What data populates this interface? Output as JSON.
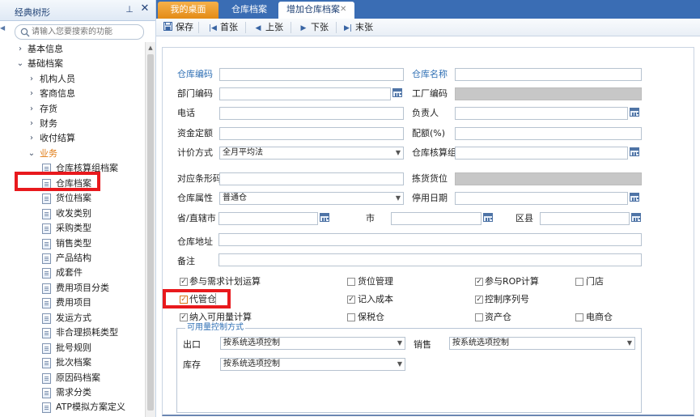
{
  "tree": {
    "title": "经典树形",
    "pin_glyph": "⊥",
    "close_glyph": "✕",
    "collapse_glyph": "◀",
    "search_placeholder": "请输入您要搜索的功能",
    "items": [
      {
        "label": "基本信息",
        "arrow": "›"
      },
      {
        "label": "基础档案",
        "arrow": "⌄"
      },
      {
        "label": "机构人员",
        "arrow": "›"
      },
      {
        "label": "客商信息",
        "arrow": "›"
      },
      {
        "label": "存货",
        "arrow": "›"
      },
      {
        "label": "财务",
        "arrow": "›"
      },
      {
        "label": "收付结算",
        "arrow": "›"
      },
      {
        "label": "业务",
        "arrow": "⌄"
      },
      {
        "label": "仓库核算组档案"
      },
      {
        "label": "仓库档案"
      },
      {
        "label": "货位档案"
      },
      {
        "label": "收发类别"
      },
      {
        "label": "采购类型"
      },
      {
        "label": "销售类型"
      },
      {
        "label": "产品结构"
      },
      {
        "label": "成套件"
      },
      {
        "label": "费用项目分类"
      },
      {
        "label": "费用项目"
      },
      {
        "label": "发运方式"
      },
      {
        "label": "非合理损耗类型"
      },
      {
        "label": "批号规则"
      },
      {
        "label": "批次档案"
      },
      {
        "label": "原因码档案"
      },
      {
        "label": "需求分类"
      },
      {
        "label": "ATP模拟方案定义"
      }
    ],
    "scroll_up_glyph": "▲"
  },
  "tabs": {
    "desktop": "我的桌面",
    "warehouse": "仓库档案",
    "add": "增加仓库档案",
    "close_glyph": "✕"
  },
  "toolbar": {
    "save": "保存",
    "first": "首张",
    "prev": "上张",
    "next": "下张",
    "last": "末张"
  },
  "form": {
    "labels": {
      "code": "仓库编码",
      "name": "仓库名称",
      "dept": "部门编码",
      "factory": "工厂编码",
      "phone": "电话",
      "manager": "负责人",
      "quota": "资金定额",
      "ratio": "配额(%)",
      "pricing": "计价方式",
      "acct_group": "仓库核算组",
      "barcode": "对应条形码",
      "picking": "拣货货位",
      "attr": "仓库属性",
      "stop_date": "停用日期",
      "province": "省/直辖市",
      "city": "市",
      "district": "区县",
      "address": "仓库地址",
      "remark": "备注"
    },
    "values": {
      "pricing": "全月平均法",
      "attr": "普通仓"
    },
    "checkboxes": {
      "mrp": "参与需求计划运算",
      "location_mgmt": "货位管理",
      "rop": "参与ROP计算",
      "store": "门店",
      "consign": "代管仓",
      "cost": "记入成本",
      "serial": "控制序列号",
      "available": "纳入可用量计算",
      "bonded": "保税仓",
      "asset": "资产仓",
      "ecom": "电商仓"
    },
    "check_mark": "✓",
    "group": {
      "title": "可用量控制方式",
      "outbound_label": "出口",
      "outbound_value": "按系统选项控制",
      "sales_label": "销售",
      "sales_value": "按系统选项控制",
      "stock_label": "库存",
      "stock_value": "按系统选项控制"
    },
    "dropdown_glyph": "▼"
  },
  "colors": {
    "accent_blue": "#3a6db4",
    "tab_orange": "#e38b16",
    "highlight_red": "#e8191d",
    "label_blue": "#2f6fb4"
  }
}
